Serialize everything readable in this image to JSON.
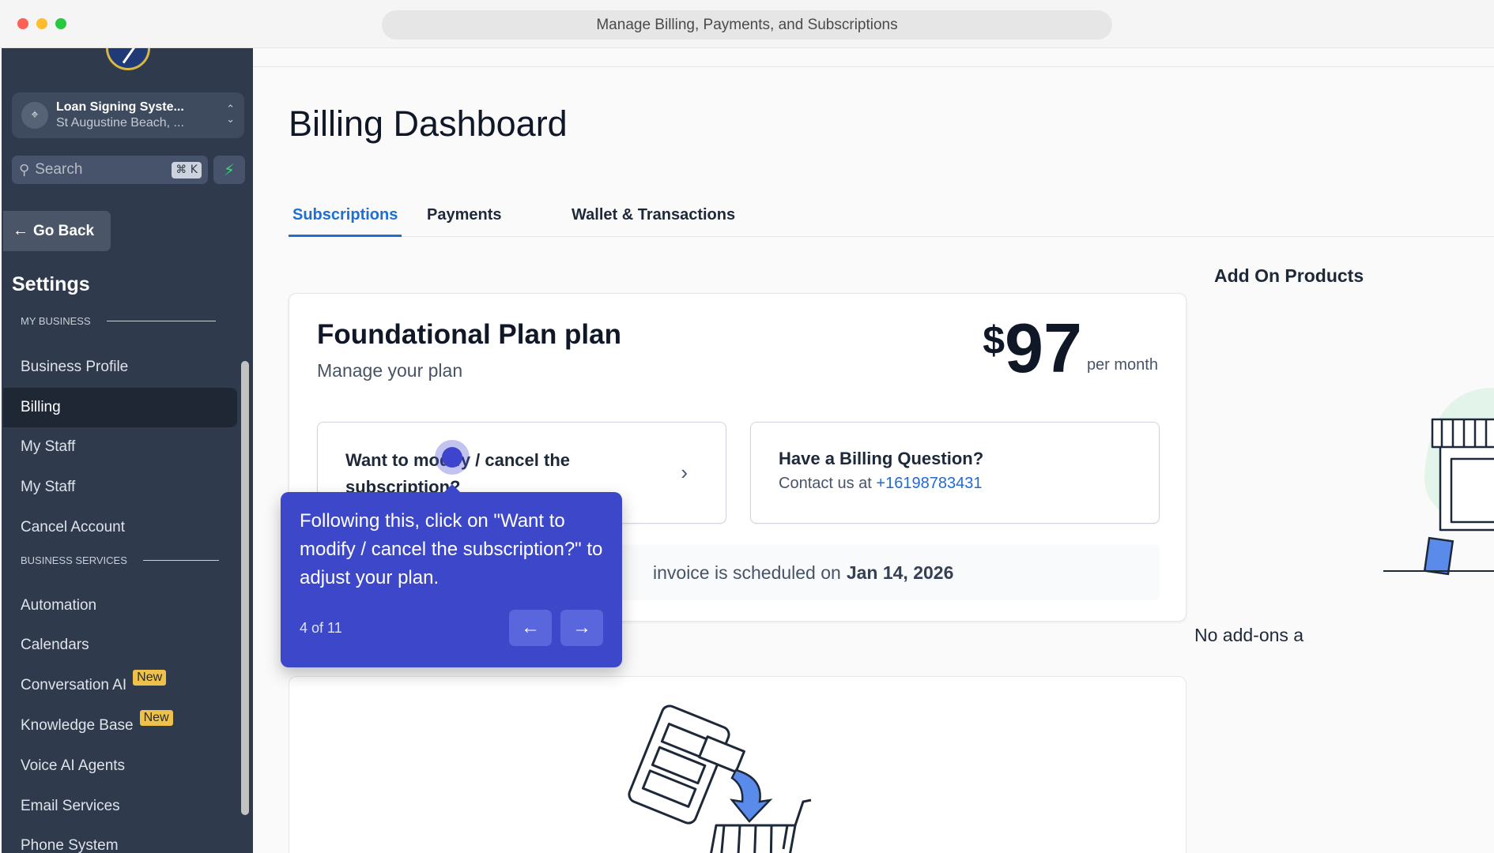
{
  "window": {
    "title": "Manage Billing, Payments, and Subscriptions"
  },
  "sidebar": {
    "location": {
      "name": "Loan Signing Syste...",
      "address": "St Augustine Beach, ..."
    },
    "search": {
      "placeholder": "Search",
      "shortcut": "⌘ K"
    },
    "go_back": "Go Back",
    "settings_title": "Settings",
    "sections": [
      {
        "label": "MY BUSINESS"
      },
      {
        "label": "BUSINESS SERVICES"
      }
    ],
    "items": [
      {
        "label": "Business Profile"
      },
      {
        "label": "Billing"
      },
      {
        "label": "My Staff"
      },
      {
        "label": "My Staff"
      },
      {
        "label": "Cancel Account"
      },
      {
        "label": "Automation"
      },
      {
        "label": "Calendars"
      },
      {
        "label": "Conversation AI",
        "badge": "New"
      },
      {
        "label": "Knowledge Base",
        "badge": "New"
      },
      {
        "label": "Voice AI Agents"
      },
      {
        "label": "Email Services"
      },
      {
        "label": "Phone System"
      }
    ]
  },
  "main": {
    "title": "Billing Dashboard",
    "tabs": [
      {
        "label": "Subscriptions"
      },
      {
        "label": "Payments"
      },
      {
        "label": "Wallet & Transactions"
      }
    ],
    "plan": {
      "name": "Foundational Plan plan",
      "subtitle": "Manage your plan",
      "currency": "$",
      "price": "97",
      "period": "per month",
      "modify_card": {
        "title": "Want to modify / cancel the subscription?"
      },
      "question_card": {
        "title": "Have a Billing Question?",
        "contact_prefix": "Contact us at",
        "phone": "+16198783431"
      },
      "invoice": {
        "text": "invoice is scheduled on",
        "date": "Jan 14, 2026"
      }
    },
    "addons": {
      "title": "Add On Products",
      "empty": "No add-ons a"
    }
  },
  "walkthrough": {
    "text": "Following this, click on \"Want to modify / cancel the subscription?\" to adjust your plan.",
    "step": "4 of 11"
  },
  "colors": {
    "sidebar_bg": "#2f3a4d",
    "accent": "#1f6fd1",
    "tooltip_bg": "#3c48c9",
    "badge": "#eec24a"
  }
}
